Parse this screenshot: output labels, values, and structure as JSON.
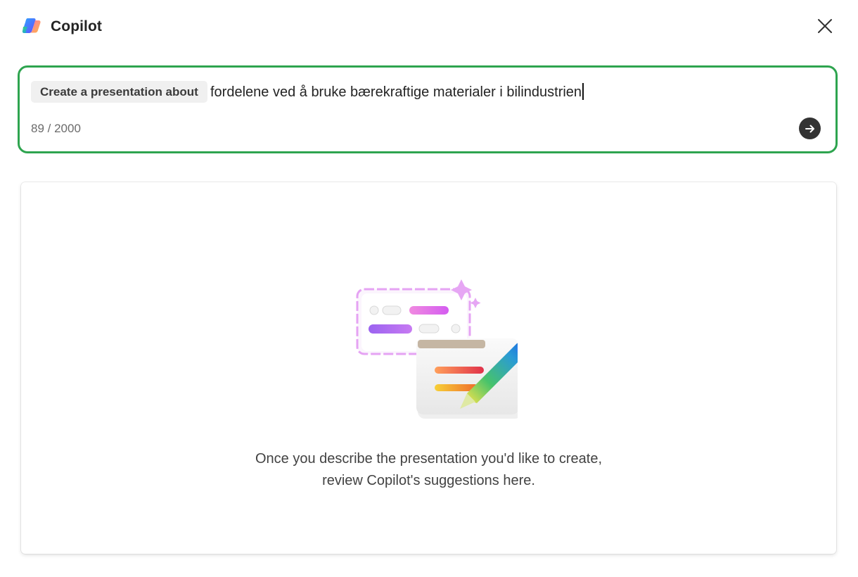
{
  "header": {
    "title": "Copilot",
    "logo_icon": "copilot-logo-icon",
    "close_icon": "close-icon"
  },
  "prompt": {
    "prefix_chip": "Create a presentation about",
    "input_value": "fordelene ved å bruke bærekraftige materialer i bilindustrien",
    "char_count": "89 / 2000",
    "send_icon": "arrow-right-icon",
    "focus_border_color": "#2ea44f"
  },
  "suggestions": {
    "illustration_icon": "presentation-pen-illustration",
    "empty_line_1": "Once you describe the presentation you'd like to create,",
    "empty_line_2": "review Copilot's suggestions here."
  }
}
